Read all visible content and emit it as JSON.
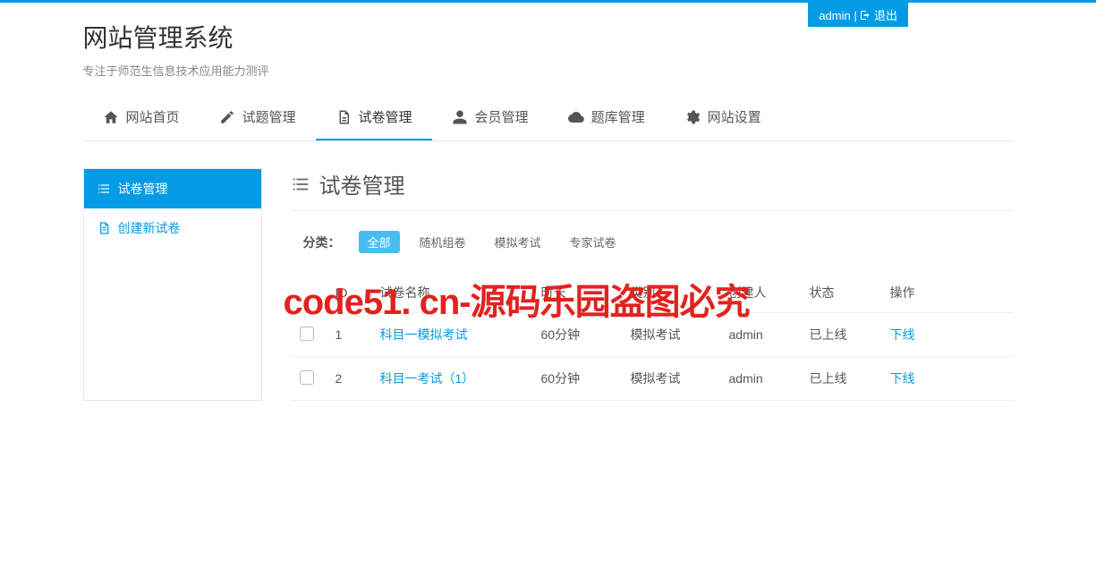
{
  "user": {
    "name": "admin",
    "logout": "退出"
  },
  "site": {
    "title": "网站管理系统",
    "subtitle": "专注于师范生信息技术应用能力测评"
  },
  "nav": {
    "items": [
      {
        "label": "网站首页"
      },
      {
        "label": "试题管理"
      },
      {
        "label": "试卷管理"
      },
      {
        "label": "会员管理"
      },
      {
        "label": "题库管理"
      },
      {
        "label": "网站设置"
      }
    ]
  },
  "sidebar": {
    "items": [
      {
        "label": "试卷管理"
      },
      {
        "label": "创建新试卷"
      }
    ]
  },
  "page": {
    "heading": "试卷管理"
  },
  "filter": {
    "label": "分类：",
    "tags": [
      {
        "label": "全部"
      },
      {
        "label": "随机组卷"
      },
      {
        "label": "模拟考试"
      },
      {
        "label": "专家试卷"
      }
    ]
  },
  "table": {
    "headers": {
      "id": "ID",
      "name": "试卷名称",
      "duration": "时长",
      "type": "类别",
      "creator": "创建人",
      "status": "状态",
      "action": "操作"
    },
    "rows": [
      {
        "id": "1",
        "name": "科目一模拟考试",
        "duration": "60分钟",
        "type": "模拟考试",
        "creator": "admin",
        "status": "已上线",
        "action": "下线"
      },
      {
        "id": "2",
        "name": "科目一考试（1）",
        "duration": "60分钟",
        "type": "模拟考试",
        "creator": "admin",
        "status": "已上线",
        "action": "下线"
      }
    ]
  },
  "watermark": "code51. cn-源码乐园盗图必究"
}
